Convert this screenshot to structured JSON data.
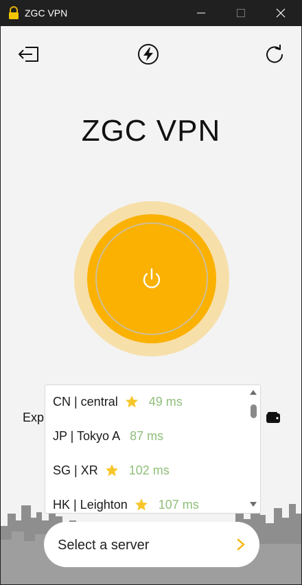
{
  "window": {
    "title": "ZGC VPN",
    "lock_icon": "lock-icon",
    "minimize_icon": "minimize-icon",
    "maximize_icon": "maximize-icon",
    "close_icon": "close-icon"
  },
  "toolbar": {
    "logout_icon": "logout-icon",
    "speed_icon": "lightning-icon",
    "refresh_icon": "refresh-icon"
  },
  "app": {
    "title": "ZGC VPN",
    "power_icon": "power-icon",
    "expire_text_visible": "Exp",
    "wallet_icon": "wallet-icon"
  },
  "server_list": {
    "items": [
      {
        "name": "CN | central",
        "favorite": true,
        "ping": "49 ms"
      },
      {
        "name": "JP | Tokyo A",
        "favorite": false,
        "ping": "87 ms"
      },
      {
        "name": "SG | XR",
        "favorite": true,
        "ping": "102 ms"
      },
      {
        "name": "HK | Leighton",
        "favorite": true,
        "ping": "107 ms"
      }
    ]
  },
  "select_server": {
    "label": "Select a server"
  },
  "colors": {
    "accent": "#fab101",
    "halo": "#f7dfa9",
    "ping": "#8fbf7a",
    "star": "#f7c62b",
    "background": "#f3f3f3",
    "titlebar": "#202020"
  }
}
